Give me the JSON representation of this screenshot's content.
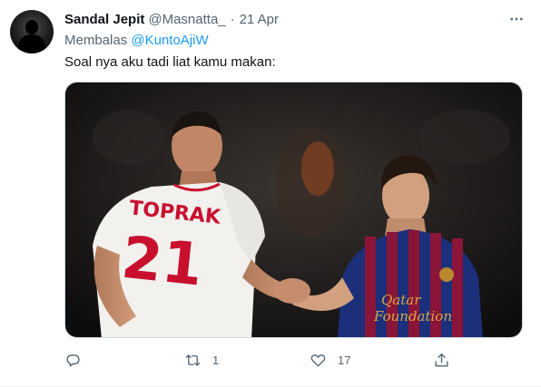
{
  "author": {
    "display_name": "Sandal Jepit",
    "handle": "@Masnatta_",
    "separator": "·",
    "date": "21 Apr",
    "avatar": "avatar-silhouette"
  },
  "reply_context": {
    "prefix": "Membalas",
    "mention": "@KuntoAjiW"
  },
  "tweet": {
    "text": "Soal nya aku tadi liat kamu makan:"
  },
  "media": {
    "jersey_name": "TOPRAK",
    "jersey_number": "21",
    "sponsor_line1": "Qatar",
    "sponsor_line2": "Foundation"
  },
  "actions": {
    "reply": {
      "icon": "reply-icon",
      "count": ""
    },
    "retweet": {
      "icon": "retweet-icon",
      "count": "1"
    },
    "like": {
      "icon": "heart-icon",
      "count": "17"
    },
    "share": {
      "icon": "share-icon",
      "count": ""
    }
  },
  "colors": {
    "text": "#0f1419",
    "secondary": "#536471",
    "link": "#1d9bf0",
    "border": "#cfd9de"
  }
}
